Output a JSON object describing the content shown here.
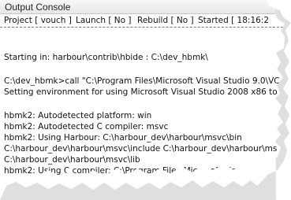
{
  "window": {
    "title": "Output Console"
  },
  "toolbar": {
    "project": "Project [ vouch ]",
    "launch": "Launch [ No ]",
    "rebuild": "Rebuild [ No ]",
    "started": "Started [ 18:16:2"
  },
  "console": {
    "lines": [
      "Starting in: harbour\\contrib\\hbide : C:\\dev_hbmk\\",
      "C:\\dev_hbmk>call \"C:\\Program Files\\Microsoft Visual Studio 9.0\\VC",
      "Setting environment for using Microsoft Visual Studio 2008 x86 to",
      "hbmk2: Autodetected platform: win",
      "hbmk2: Autodetected C compiler: msvc",
      "hbmk2: Using Harbour: C:\\harbour_dev\\harbour\\msvc\\bin",
      "C:\\harbour_dev\\harbour\\msvc\\include C:\\harbour_dev\\harbour\\ms",
      "C:\\harbour_dev\\harbour\\msvc\\lib",
      "hbmk2: Using C compiler: C:\\Program Files\\Microsoft Visual Stu"
    ]
  },
  "colors": {
    "text": "#111111",
    "titlebar_top": "#f8f8f8",
    "titlebar_bottom": "#e7e7e7",
    "shadow": "#b8b8b8"
  }
}
